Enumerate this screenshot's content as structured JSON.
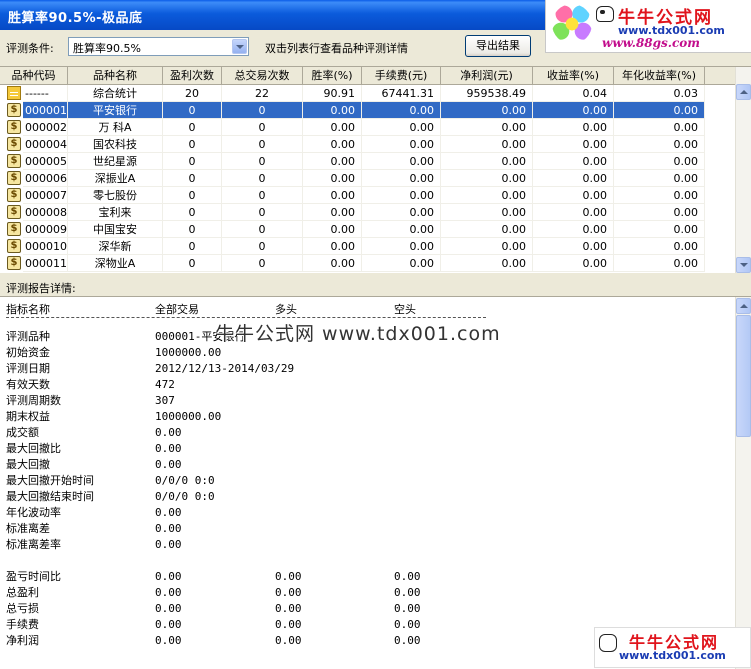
{
  "window": {
    "title": "胜算率90.5%-极品底"
  },
  "logo": {
    "name": "牛牛公式网",
    "url1": "www.tdx001.com",
    "url2": "www.88gs.com"
  },
  "toolbar": {
    "condition_label": "评测条件:",
    "condition_value": "胜算率90.5%",
    "hint": "双击列表行查看品种评测详情",
    "export_label": "导出结果"
  },
  "grid": {
    "columns": [
      "品种代码",
      "品种名称",
      "盈利次数",
      "总交易次数",
      "胜率(%)",
      "手续费(元)",
      "净利润(元)",
      "收益率(%)",
      "年化收益率(%)"
    ],
    "rows": [
      {
        "code": "------",
        "name": "综合统计",
        "wins": "20",
        "trades": "22",
        "winrate": "90.91",
        "fee": "67441.31",
        "profit": "959538.49",
        "ret": "0.04",
        "annual": "0.03",
        "icon": "summary-icon"
      },
      {
        "code": "000001",
        "name": "平安银行",
        "wins": "0",
        "trades": "0",
        "winrate": "0.00",
        "fee": "0.00",
        "profit": "0.00",
        "ret": "0.00",
        "annual": "0.00",
        "icon": "stock-icon",
        "selected": true
      },
      {
        "code": "000002",
        "name": "万  科A",
        "wins": "0",
        "trades": "0",
        "winrate": "0.00",
        "fee": "0.00",
        "profit": "0.00",
        "ret": "0.00",
        "annual": "0.00",
        "icon": "stock-icon"
      },
      {
        "code": "000004",
        "name": "国农科技",
        "wins": "0",
        "trades": "0",
        "winrate": "0.00",
        "fee": "0.00",
        "profit": "0.00",
        "ret": "0.00",
        "annual": "0.00",
        "icon": "stock-icon"
      },
      {
        "code": "000005",
        "name": "世纪星源",
        "wins": "0",
        "trades": "0",
        "winrate": "0.00",
        "fee": "0.00",
        "profit": "0.00",
        "ret": "0.00",
        "annual": "0.00",
        "icon": "stock-icon"
      },
      {
        "code": "000006",
        "name": "深振业A",
        "wins": "0",
        "trades": "0",
        "winrate": "0.00",
        "fee": "0.00",
        "profit": "0.00",
        "ret": "0.00",
        "annual": "0.00",
        "icon": "stock-icon"
      },
      {
        "code": "000007",
        "name": "零七股份",
        "wins": "0",
        "trades": "0",
        "winrate": "0.00",
        "fee": "0.00",
        "profit": "0.00",
        "ret": "0.00",
        "annual": "0.00",
        "icon": "stock-icon"
      },
      {
        "code": "000008",
        "name": "宝利来",
        "wins": "0",
        "trades": "0",
        "winrate": "0.00",
        "fee": "0.00",
        "profit": "0.00",
        "ret": "0.00",
        "annual": "0.00",
        "icon": "stock-icon"
      },
      {
        "code": "000009",
        "name": "中国宝安",
        "wins": "0",
        "trades": "0",
        "winrate": "0.00",
        "fee": "0.00",
        "profit": "0.00",
        "ret": "0.00",
        "annual": "0.00",
        "icon": "stock-icon"
      },
      {
        "code": "000010",
        "name": "深华新",
        "wins": "0",
        "trades": "0",
        "winrate": "0.00",
        "fee": "0.00",
        "profit": "0.00",
        "ret": "0.00",
        "annual": "0.00",
        "icon": "stock-icon"
      },
      {
        "code": "000011",
        "name": "深物业A",
        "wins": "0",
        "trades": "0",
        "winrate": "0.00",
        "fee": "0.00",
        "profit": "0.00",
        "ret": "0.00",
        "annual": "0.00",
        "icon": "stock-icon"
      }
    ]
  },
  "report": {
    "label": "评测报告详情:",
    "headers": [
      "指标名称",
      "全部交易",
      "多头",
      "空头"
    ],
    "watermark": "牛牛公式网 www.tdx001.com",
    "rows": [
      {
        "k": "评测品种",
        "v1": "000001-平安银行",
        "v2": "",
        "v3": ""
      },
      {
        "k": "初始资金",
        "v1": "1000000.00",
        "v2": "",
        "v3": ""
      },
      {
        "k": "评测日期",
        "v1": "2012/12/13-2014/03/29",
        "v2": "",
        "v3": ""
      },
      {
        "k": "有效天数",
        "v1": "472",
        "v2": "",
        "v3": ""
      },
      {
        "k": "评测周期数",
        "v1": "307",
        "v2": "",
        "v3": ""
      },
      {
        "k": "期末权益",
        "v1": "1000000.00",
        "v2": "",
        "v3": ""
      },
      {
        "k": "成交额",
        "v1": "0.00",
        "v2": "",
        "v3": ""
      },
      {
        "k": "最大回撤比",
        "v1": "0.00",
        "v2": "",
        "v3": ""
      },
      {
        "k": "最大回撤",
        "v1": "0.00",
        "v2": "",
        "v3": ""
      },
      {
        "k": "最大回撤开始时间",
        "v1": "0/0/0 0:0",
        "v2": "",
        "v3": ""
      },
      {
        "k": "最大回撤结束时间",
        "v1": "0/0/0 0:0",
        "v2": "",
        "v3": ""
      },
      {
        "k": "年化波动率",
        "v1": "0.00",
        "v2": "",
        "v3": ""
      },
      {
        "k": "标准离差",
        "v1": "0.00",
        "v2": "",
        "v3": ""
      },
      {
        "k": "标准离差率",
        "v1": "0.00",
        "v2": "",
        "v3": ""
      },
      {
        "k": "",
        "v1": "",
        "v2": "",
        "v3": ""
      },
      {
        "k": "盈亏时间比",
        "v1": "0.00",
        "v2": "0.00",
        "v3": "0.00"
      },
      {
        "k": "总盈利",
        "v1": "0.00",
        "v2": "0.00",
        "v3": "0.00"
      },
      {
        "k": "总亏损",
        "v1": "0.00",
        "v2": "0.00",
        "v3": "0.00"
      },
      {
        "k": "手续费",
        "v1": "0.00",
        "v2": "0.00",
        "v3": "0.00"
      },
      {
        "k": "净利润",
        "v1": "0.00",
        "v2": "0.00",
        "v3": "0.00"
      }
    ]
  },
  "colors": {
    "title_bar": "#0b5bdc",
    "selection": "#316ac5",
    "window_bg": "#ece9d8",
    "logo_red": "#e0141c",
    "logo_blue": "#1a3cb3"
  }
}
